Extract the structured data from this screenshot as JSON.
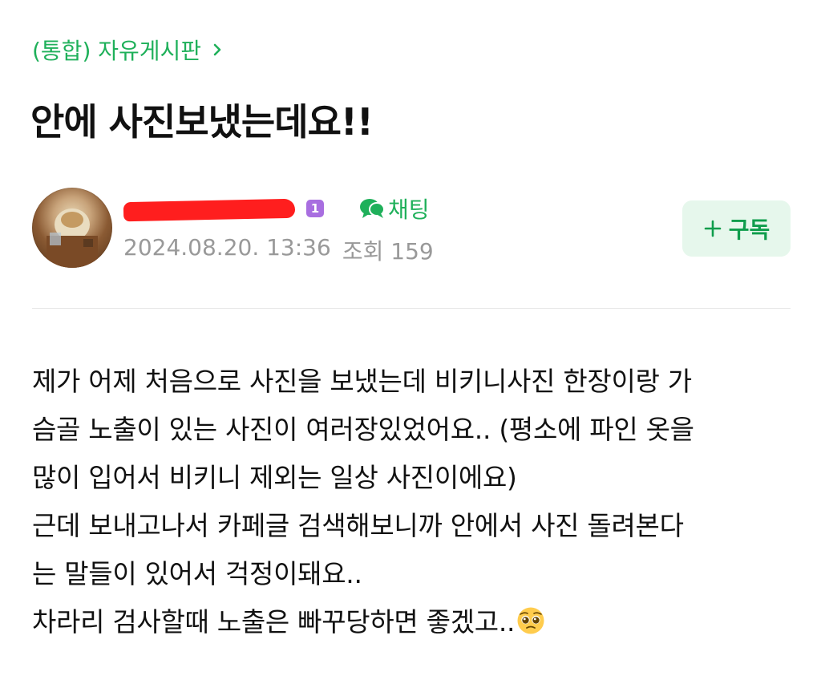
{
  "board": {
    "link_label": "(통합) 자유게시판",
    "chevron_icon": "chevron-right-icon"
  },
  "post": {
    "title": "안에 사진보냈는데요!!",
    "author": {
      "name": "",
      "level_badge": "1",
      "avatar_icon": "user-avatar"
    },
    "chat_label": "채팅",
    "date": "2024.08.20. 13:36",
    "views_label": "조회",
    "views": "159",
    "subscribe_label": "구독",
    "body_lines": [
      "제가 어제 처음으로 사진을 보냈는데 비키니사진 한장이랑 가",
      "슴골 노출이 있는 사진이 여러장있었어요.. (평소에 파인 옷을",
      "많이 입어서 비키니 제외는 일상 사진이에요)",
      "근데 보내고나서 카페글 검색해보니까 안에서 사진 돌려본다",
      "는 말들이 있어서 걱정이돼요..",
      "차라리 검사할때 노출은 빠꾸당하면 좋겠고.."
    ],
    "trailing_emoji": "pleading-face-emoji"
  },
  "colors": {
    "accent_green": "#1fb05a",
    "subscribe_bg": "#e6f7ec",
    "level_badge": "#a86ee0",
    "redaction": "#ff1e1e",
    "meta_gray": "#999999"
  }
}
